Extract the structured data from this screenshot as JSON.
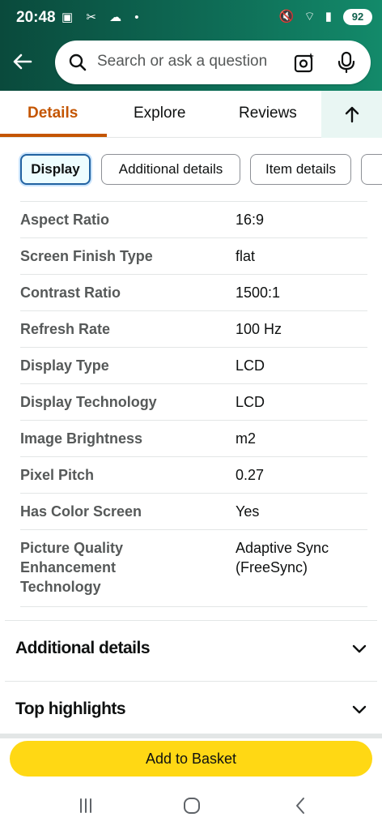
{
  "status_bar": {
    "time": "20:48",
    "left_icons": "▣ ✂ ☁ •",
    "right_icons": "🔇 ⌔ ▮",
    "battery": "92"
  },
  "search": {
    "placeholder": "Search or ask a question"
  },
  "tabs": [
    {
      "label": "Details",
      "active": true
    },
    {
      "label": "Explore",
      "active": false
    },
    {
      "label": "Reviews",
      "active": false
    }
  ],
  "chips": [
    {
      "label": "Display",
      "selected": true
    },
    {
      "label": "Additional details",
      "selected": false
    },
    {
      "label": "Item details",
      "selected": false
    }
  ],
  "specs": [
    {
      "key": "Aspect Ratio",
      "value": "16:9"
    },
    {
      "key": "Screen Finish Type",
      "value": "flat"
    },
    {
      "key": "Contrast Ratio",
      "value": "1500:1"
    },
    {
      "key": "Refresh Rate",
      "value": "100 Hz"
    },
    {
      "key": "Display Type",
      "value": "LCD"
    },
    {
      "key": "Display Technology",
      "value": "LCD"
    },
    {
      "key": "Image Brightness",
      "value": "m2"
    },
    {
      "key": "Pixel Pitch",
      "value": "0.27"
    },
    {
      "key": "Has Color Screen",
      "value": "Yes"
    },
    {
      "key": "Picture Quality Enhancement Technology",
      "value": "Adaptive Sync (FreeSync)"
    }
  ],
  "accordions": [
    {
      "title": "Additional details"
    },
    {
      "title": "Top highlights"
    }
  ],
  "add_to_basket": "Add to Basket",
  "colors": {
    "header": "#0e6b55",
    "accent": "#c45500",
    "button": "#ffd814",
    "chip_selected": "#2162a1"
  }
}
